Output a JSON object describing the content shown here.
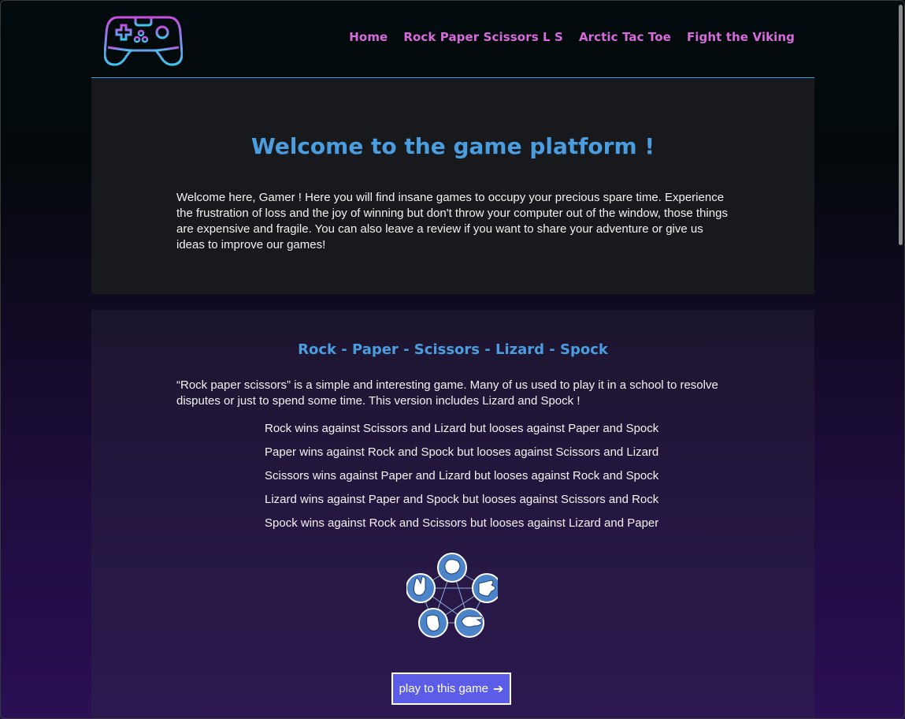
{
  "nav": {
    "items": [
      {
        "label": "Home"
      },
      {
        "label": "Rock Paper Scissors L S"
      },
      {
        "label": "Arctic Tac Toe"
      },
      {
        "label": "Fight the Viking"
      }
    ]
  },
  "welcome": {
    "title": "Welcome to the game platform !",
    "text": "Welcome here, Gamer ! Here you will find insane games to occupy your precious spare time. Experience the frustration of loss and the joy of winning but don't throw your computer out of the window, those things are expensive and fragile. You can also leave a review if you want to share your adventure or give us ideas to improve our games!"
  },
  "game": {
    "title": "Rock - Paper - Scissors - Lizard - Spock",
    "intro": "“Rock paper scissors” is a simple and interesting game. Many of us used to play it in a school to resolve disputes or just to spend some time. This version includes Lizard and Spock !",
    "rules": [
      "Rock wins against Scissors and Lizard but looses against Paper and Spock",
      "Paper wins against Rock and Spock but looses against Scissors and Lizard",
      "Scissors wins against Paper and Lizard but looses against Rock and Spock",
      "Lizard wins against Paper and Spock but looses against Scissors and Rock",
      "Spock wins against Rock and Scissors but looses against Lizard and Paper"
    ],
    "play_button": "play to this game",
    "play_icon": "arrow-right-icon"
  },
  "colors": {
    "nav_link": "#d76bdb",
    "heading": "#4a9ee0",
    "button": "#5b5ce8",
    "divider": "#3e9bd8"
  }
}
